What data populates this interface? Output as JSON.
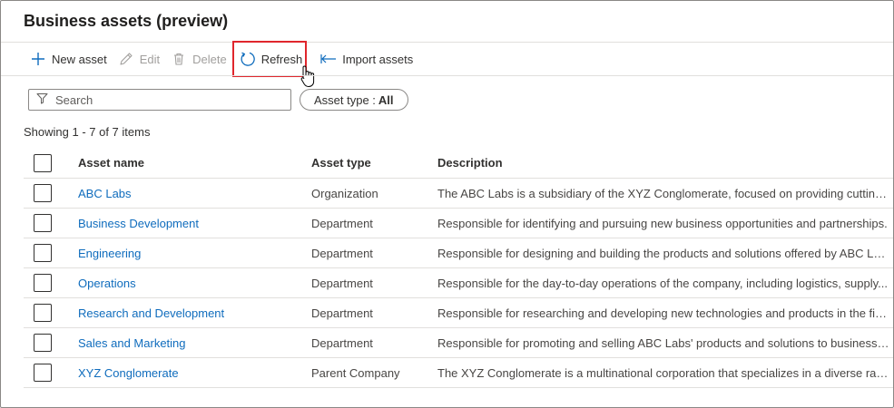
{
  "page": {
    "title": "Business assets (preview)"
  },
  "toolbar": {
    "new_label": "New asset",
    "edit_label": "Edit",
    "delete_label": "Delete",
    "refresh_label": "Refresh",
    "import_label": "Import assets"
  },
  "filters": {
    "search_placeholder": "Search",
    "asset_type_label": "Asset type :",
    "asset_type_value": "All"
  },
  "showing_text": "Showing 1 - 7 of 7 items",
  "table": {
    "columns": [
      "Asset name",
      "Asset type",
      "Description"
    ],
    "rows": [
      {
        "name": "ABC Labs",
        "type": "Organization",
        "description": "The ABC Labs is a subsidiary of the XYZ Conglomerate, focused on providing cutting-..."
      },
      {
        "name": "Business Development",
        "type": "Department",
        "description": "Responsible for identifying and pursuing new business opportunities and partnerships."
      },
      {
        "name": "Engineering",
        "type": "Department",
        "description": "Responsible for designing and building the products and solutions offered by ABC La..."
      },
      {
        "name": "Operations",
        "type": "Department",
        "description": "Responsible for the day-to-day operations of the company, including logistics, supply..."
      },
      {
        "name": "Research and Development",
        "type": "Department",
        "description": "Responsible for researching and developing new technologies and products in the fie..."
      },
      {
        "name": "Sales and Marketing",
        "type": "Department",
        "description": "Responsible for promoting and selling ABC Labs' products and solutions to businesse..."
      },
      {
        "name": "XYZ Conglomerate",
        "type": "Parent Company",
        "description": "The XYZ Conglomerate is a multinational corporation that specializes in a diverse ran..."
      }
    ]
  },
  "colors": {
    "accent": "#0f6cbd",
    "highlight": "#e0262d",
    "border": "#e1dfdd"
  }
}
